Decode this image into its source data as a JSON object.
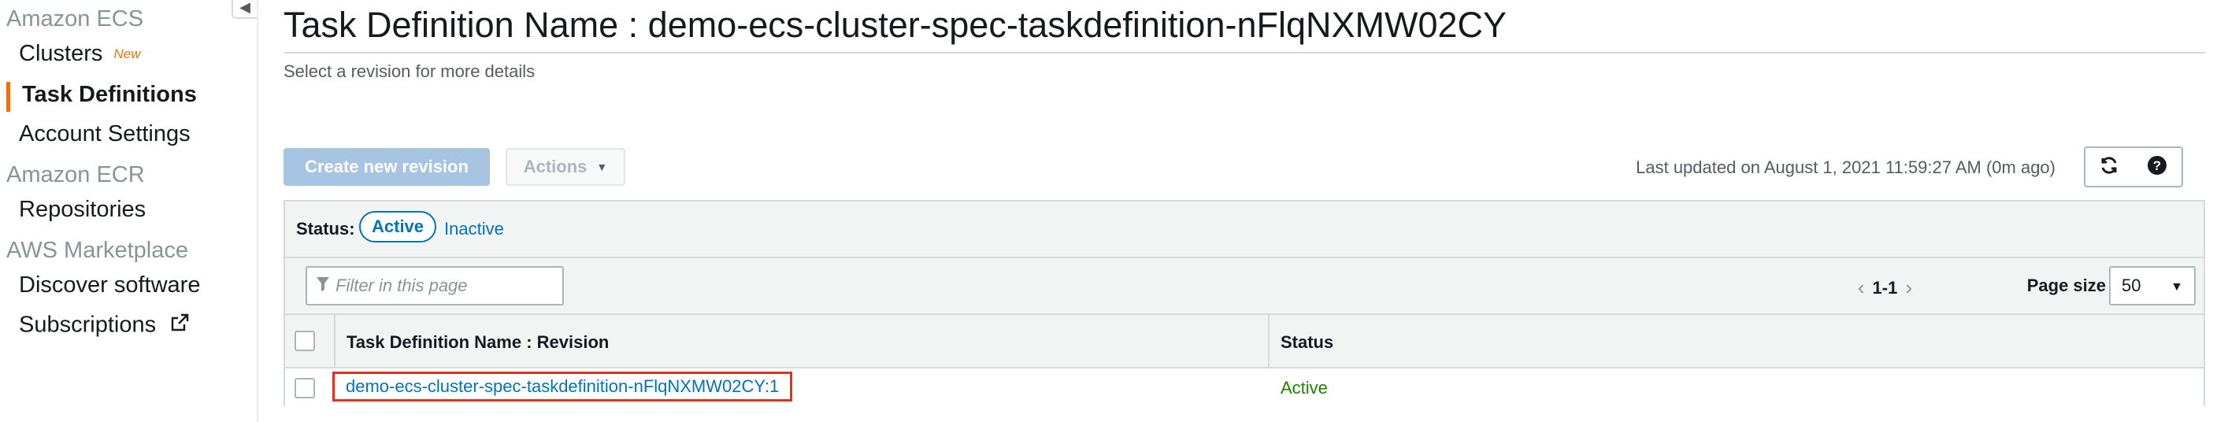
{
  "sidebar": {
    "sections": [
      {
        "heading": "Amazon ECS",
        "items": [
          {
            "label": "Clusters",
            "badge": "New"
          },
          {
            "label": "Task Definitions",
            "active": true
          },
          {
            "label": "Account Settings"
          }
        ]
      },
      {
        "heading": "Amazon ECR",
        "items": [
          {
            "label": "Repositories"
          }
        ]
      },
      {
        "heading": "AWS Marketplace",
        "items": [
          {
            "label": "Discover software"
          },
          {
            "label": "Subscriptions",
            "icon": "external-link-icon"
          }
        ]
      }
    ],
    "collapse_icon": "chevron-left-icon"
  },
  "page": {
    "title": "Task Definition Name : demo-ecs-cluster-spec-taskdefinition-nFlqNXMW02CY",
    "subtitle": "Select a revision for more details"
  },
  "toolbar": {
    "create_label": "Create new revision",
    "actions_label": "Actions",
    "last_updated": "Last updated on August 1, 2021 11:59:27 AM (0m ago)",
    "refresh_icon": "refresh-icon",
    "help_icon": "help-icon"
  },
  "status_filter": {
    "label": "Status:",
    "active": "Active",
    "inactive": "Inactive"
  },
  "filter": {
    "placeholder": "Filter in this page",
    "icon": "filter-icon"
  },
  "pagination": {
    "range": "1-1",
    "page_size_label": "Page size",
    "page_size": "50"
  },
  "table": {
    "columns": [
      "Task Definition Name : Revision",
      "Status"
    ],
    "rows": [
      {
        "name": "demo-ecs-cluster-spec-taskdefinition-nFlqNXMW02CY:1",
        "status": "Active"
      }
    ]
  },
  "colors": {
    "accent": "#ec7211",
    "link": "#0073bb",
    "status_active": "#1d8102",
    "highlight_box": "#e0301e",
    "primary_button_disabled": "#a7c5e3"
  }
}
